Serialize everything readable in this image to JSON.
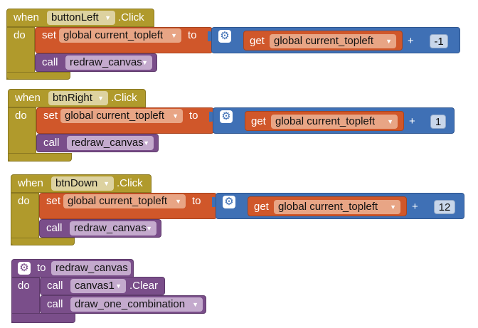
{
  "blocks": [
    {
      "event_keyword": "when",
      "component": "buttonLeft",
      "event": ".Click",
      "do_keyword": "do",
      "set_keyword": "set",
      "variable": "global current_topleft",
      "to_keyword": "to",
      "get_keyword": "get",
      "get_variable": "global current_topleft",
      "operator": "+",
      "operand": "-1",
      "call_keyword": "call",
      "procedure": "redraw_canvas"
    },
    {
      "event_keyword": "when",
      "component": "btnRight",
      "event": ".Click",
      "do_keyword": "do",
      "set_keyword": "set",
      "variable": "global current_topleft",
      "to_keyword": "to",
      "get_keyword": "get",
      "get_variable": "global current_topleft",
      "operator": "+",
      "operand": "1",
      "call_keyword": "call",
      "procedure": "redraw_canvas"
    },
    {
      "event_keyword": "when",
      "component": "btnDown",
      "event": ".Click",
      "do_keyword": "do",
      "set_keyword": "set",
      "variable": "global current_topleft",
      "to_keyword": "to",
      "get_keyword": "get",
      "get_variable": "global current_topleft",
      "operator": "+",
      "operand": "12",
      "call_keyword": "call",
      "procedure": "redraw_canvas"
    }
  ],
  "procedure_def": {
    "to_keyword": "to",
    "name": "redraw_canvas",
    "do_keyword": "do",
    "call1_keyword": "call",
    "call1_component": "canvas1",
    "call1_method": ".Clear",
    "call2_keyword": "call",
    "call2_procedure": "draw_one_combination"
  },
  "icons": {
    "mutator": "gear-icon",
    "dropdown": "dropdown-arrow-icon"
  },
  "colors": {
    "event": "#b09a2c",
    "variable": "#d0572a",
    "math": "#3f70b5",
    "procedure": "#7a4e8a"
  }
}
